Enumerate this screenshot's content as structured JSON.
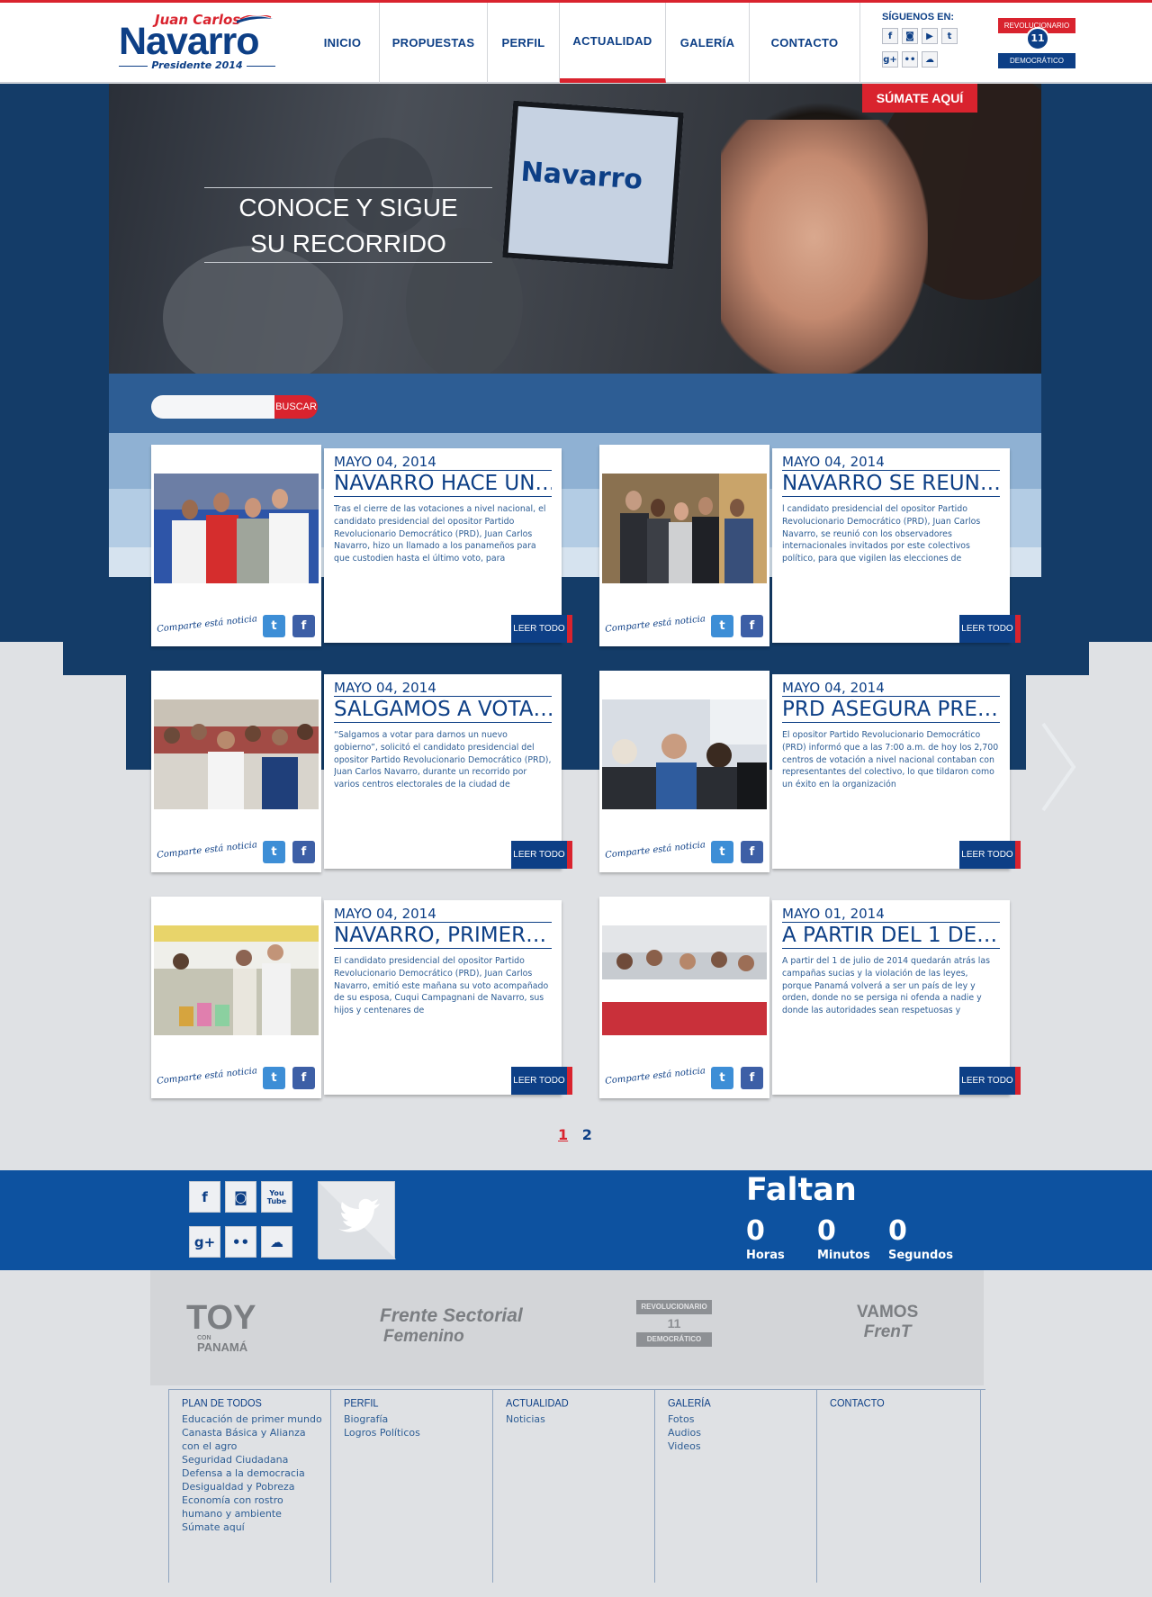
{
  "header": {
    "logo_small": "Juan Carlos",
    "logo_big": "Navarro",
    "logo_sub": "Presidente 2014",
    "nav": [
      {
        "label": "INICIO",
        "width": 0
      },
      {
        "label": "PROPUESTAS"
      },
      {
        "label": "PERFIL"
      },
      {
        "label": "ACTUALIDAD",
        "active": true
      },
      {
        "label": "GALERÍA"
      },
      {
        "label": "CONTACTO"
      }
    ],
    "follow_label": "SÍGUENOS EN:",
    "follow_icons": [
      "f",
      "◙",
      "▶",
      "t",
      "g+",
      "••",
      "☁"
    ],
    "party_top": "REVOLUCIONARIO",
    "party_num": "11",
    "party_bottom": "DEMOCRÁTICO"
  },
  "hero": {
    "text_line1": "CONOCE Y SIGUE",
    "text_line2": "SU RECORRIDO",
    "screen_logo": "Navarro",
    "cta": "SÚMATE AQUÍ"
  },
  "search": {
    "placeholder": "",
    "button": "BUSCAR"
  },
  "news": [
    {
      "date": "MAYO 04, 2014",
      "title": "NAVARRO HACE UN…",
      "desc": "Tras el cierre de las votaciones a nivel nacional, el candidato presidencial del opositor Partido Revolucionario Democrático (PRD), Juan Carlos Navarro, hizo un llamado a los panameños para que custodien hasta el último voto, para",
      "share": "Comparte está noticia",
      "button": "LEER TODO"
    },
    {
      "date": "MAYO 04, 2014",
      "title": "NAVARRO SE REUN…",
      "desc": "l candidato presidencial del opositor Partido Revolucionario Democrático (PRD), Juan Carlos Navarro, se reunió con los observadores internacionales invitados por este colectivos político, para que vigilen las elecciones de",
      "share": "Comparte está noticia",
      "button": "LEER TODO"
    },
    {
      "date": "MAYO 04, 2014",
      "title": "SALGAMOS A VOTA…",
      "desc": "“Salgamos a votar para darnos un nuevo gobierno”, solicitó el candidato presidencial del opositor Partido Revolucionario Democrático (PRD), Juan Carlos Navarro, durante un recorrido por varios centros electorales de la ciudad de",
      "share": "Comparte está noticia",
      "button": "LEER TODO"
    },
    {
      "date": "MAYO 04, 2014",
      "title": "PRD ASEGURA PRE…",
      "desc": "El opositor Partido Revolucionario Democrático (PRD) informó que a las 7:00 a.m. de hoy los 2,700 centros de votación a nivel nacional contaban con representantes del colectivo, lo que tildaron como un éxito en la organización",
      "share": "Comparte está noticia",
      "button": "LEER TODO"
    },
    {
      "date": "MAYO 04, 2014",
      "title": "NAVARRO, PRIMER…",
      "desc": "El candidato presidencial del opositor Partido Revolucionario Democrático (PRD), Juan Carlos Navarro, emitió este mañana su voto acompañado de su esposa, Cuqui Campagnani de Navarro, sus hijos y centenares de",
      "share": "Comparte está noticia",
      "button": "LEER TODO"
    },
    {
      "date": "MAYO 01, 2014",
      "title": "A PARTIR DEL 1 DE…",
      "desc": "A partir del 1 de julio de 2014 quedarán atrás las campañas sucias y la violación de las leyes, porque Panamá volverá a ser un país de ley y orden, donde no se persiga ni ofenda a nadie y donde las autoridades sean respetuosas y",
      "share": "Comparte está noticia",
      "button": "LEER TODO"
    }
  ],
  "pagination": {
    "current": "1",
    "next": "2"
  },
  "social": {
    "icons": [
      "f",
      "◙",
      "You Tube",
      "g+",
      "••",
      "☁"
    ],
    "twitter_box": "twitter"
  },
  "countdown": {
    "title": "Faltan",
    "hours": "0",
    "hours_label": "Horas",
    "minutes": "0",
    "minutes_label": "Minutos",
    "seconds": "0",
    "seconds_label": "Segundos"
  },
  "partners": {
    "toy_1": "TOY",
    "toy_2": "CON",
    "toy_3": "PANAMÁ",
    "frente_1": "Frente Sectorial",
    "frente_2": "Femenino",
    "prd_top": "REVOLUCIONARIO",
    "prd_num": "11",
    "prd_bottom": "DEMOCRÁTICO",
    "vamos_1": "VAMOS",
    "vamos_2": "FrenT"
  },
  "footer": {
    "columns": [
      {
        "title": "PLAN DE TODOS",
        "links": [
          "Educación de primer mundo",
          "Canasta Básica y Alianza",
          "con el agro",
          "Seguridad Ciudadana",
          "Defensa a la democracia",
          "Desigualdad y Pobreza",
          "Economía con rostro",
          "humano y ambiente",
          "Súmate aquí"
        ]
      },
      {
        "title": "PERFIL",
        "links": [
          "Biografía",
          "Logros Políticos"
        ]
      },
      {
        "title": "ACTUALIDAD",
        "links": [
          "Noticias"
        ]
      },
      {
        "title": "GALERÍA",
        "links": [
          "Fotos",
          "Audios",
          "Videos"
        ]
      },
      {
        "title": "CONTACTO",
        "links": []
      }
    ]
  },
  "colors": {
    "brand_blue": "#0d3f86",
    "brand_red": "#d9232e",
    "band_blue": "#0d52a0"
  }
}
